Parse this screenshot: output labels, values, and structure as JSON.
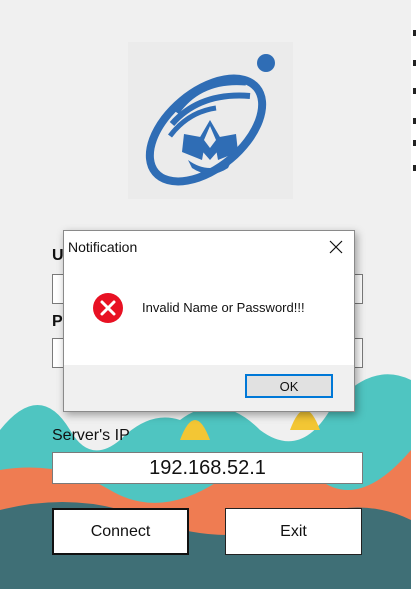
{
  "login": {
    "username_label": "U",
    "password_label": "P",
    "server_label": "Server's IP",
    "server_ip": "192.168.52.1",
    "connect_label": "Connect",
    "exit_label": "Exit"
  },
  "dialog": {
    "title": "Notification",
    "message": "Invalid Name or Password!!!",
    "ok_label": "OK",
    "icon": "error-icon"
  },
  "colors": {
    "logo_blue": "#2f6db5",
    "wave_teal": "#4fc5c1",
    "wave_orange": "#ef7c52",
    "wave_yellow": "#f3c634",
    "wave_dark": "#3f6f76",
    "error_red": "#e81123",
    "focus_blue": "#0078d7"
  }
}
